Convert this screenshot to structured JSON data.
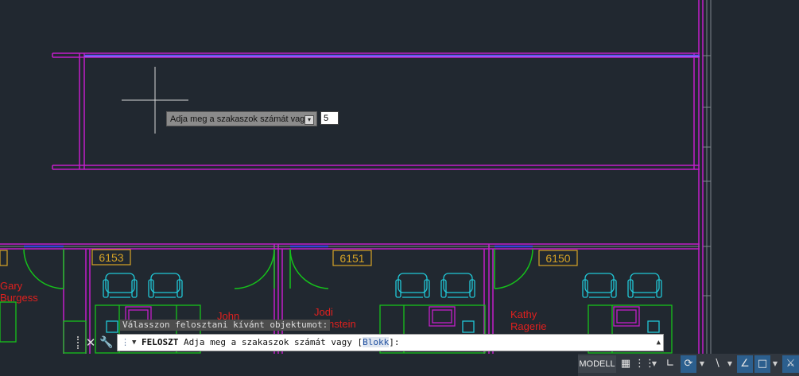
{
  "drawing": {
    "rooms": [
      {
        "id": "6153",
        "occupant": "John"
      },
      {
        "id": "6151",
        "occupant": "Jodi Fienstein"
      },
      {
        "id": "6150",
        "occupant": "Kathy Ragerie"
      }
    ],
    "partial_occupant": "Gary Burgess",
    "colors": {
      "wall": "#c21ec9",
      "door": "#16c21b",
      "chair": "#21c7d6",
      "label": "#d6a326",
      "name": "#e0201e",
      "blue": "#3840d8"
    }
  },
  "tooltip": {
    "prompt": "Adja meg a szakaszok számát vagy",
    "value": "5",
    "icon": "arrow-down-icon"
  },
  "command": {
    "history": "Válasszon felosztani kívánt objektumot:",
    "name": "FELOSZT",
    "prompt_before": " Adja meg a szakaszok számát vagy [",
    "option": "Blokk",
    "prompt_after": "]:"
  },
  "statusbar": {
    "model": "MODELL"
  }
}
